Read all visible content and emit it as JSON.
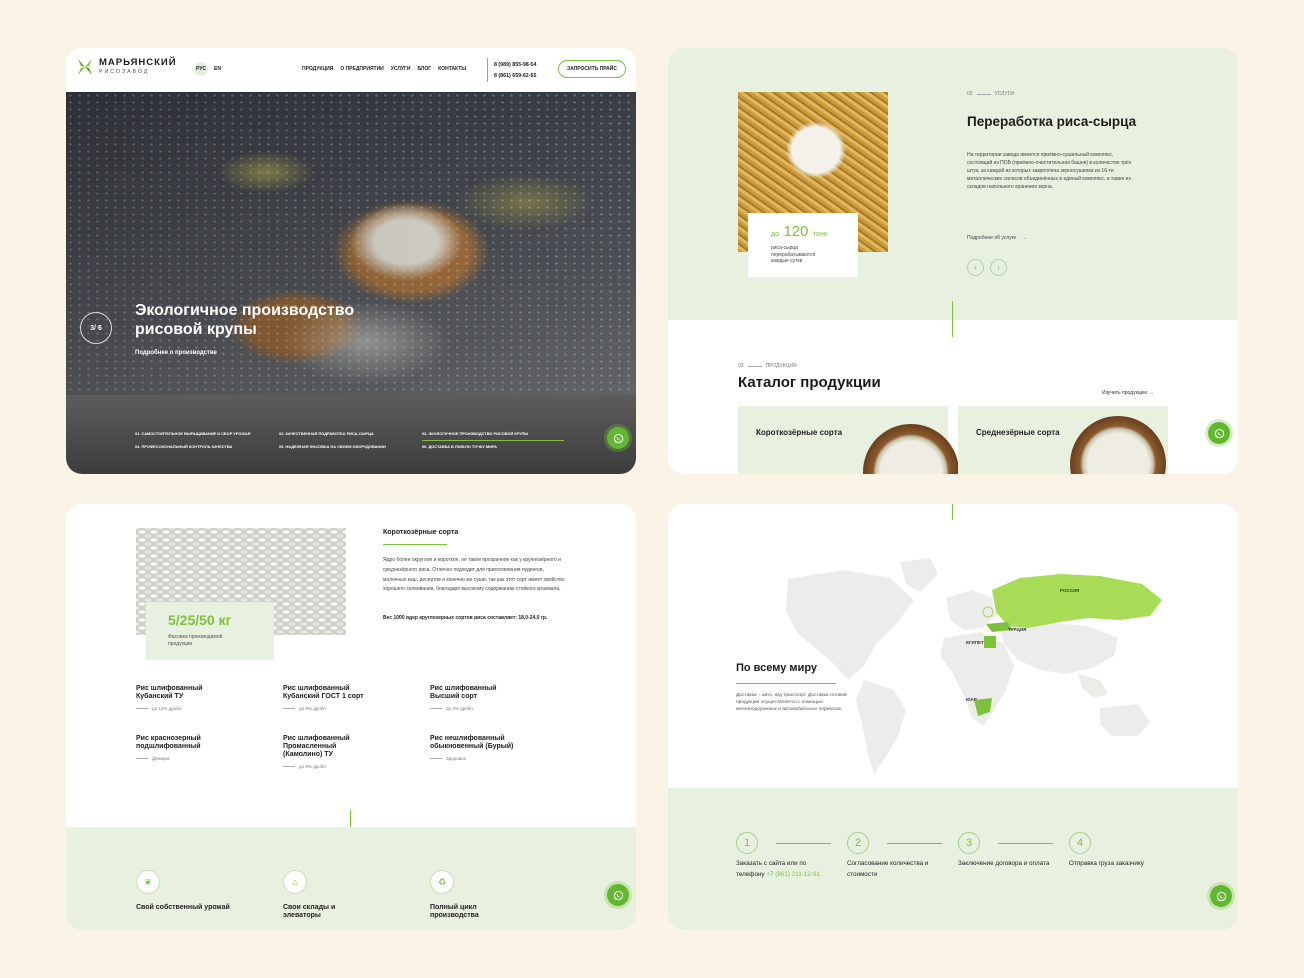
{
  "panel1": {
    "logo": {
      "title": "МАРЬЯНСКИЙ",
      "subtitle": "РИСОЗАВОД"
    },
    "lang": {
      "ru": "РУС",
      "en": "EN"
    },
    "nav": [
      "ПРОДУКЦИЯ",
      "О ПРЕДПРИЯТИИ",
      "УСЛУГИ",
      "БЛОГ",
      "КОНТАКТЫ"
    ],
    "phones": [
      "8 (989) 855-98-54",
      "8 (861) 659-62-65"
    ],
    "price_button": "ЗАПРОСИТЬ ПРАЙС",
    "slide_counter": "3/ 6",
    "hero_title": "Экологичное производство рисовой крупы",
    "hero_link": "Подробнее о производстве",
    "steps": [
      "01. САМОСТОЯТЕЛЬНОЕ ВЫРАЩИВАНИЕ И СБОР УРОЖАЯ",
      "02. КАЧЕСТВЕННАЯ ПОДРАБОТКА РИСА-СЫРЦА",
      "03. ЭКОЛОГИЧНОЕ ПРОИЗВОДСТВО РИСОВОЙ КРУПЫ",
      "04. ПРОФЕССИОНАЛЬНЫЙ КОНТРОЛЬ КАЧЕСТВА",
      "05. НАДЕЖНАЯ ФАСОВКА НА СВОЕМ ОБОРУДОВАНИИ",
      "06. ДОСТАВКА В ЛЮБУЮ ТОЧКУ МИРА"
    ],
    "active_step": 2
  },
  "panel2": {
    "eyebrow_num": "02",
    "eyebrow": "УСЛУГИ",
    "title": "Переработка риса-сырца",
    "text": "На территории завода имеется приёмно-сушильный комплекс, состоящий из ПОБ (приёмно-очистительная башня) в количестве трёх штук, за каждой из которых закреплена зерносушилка из 16-ти металлических силосов объединённых в единый комплекс, а также из складов напольного хранения зерна.",
    "more_link": "Подробнее об услуге",
    "stat_pre": "до",
    "stat_value": "120",
    "stat_unit": "тонн",
    "stat_caption": "риса-сырца перерабатываются каждые сутки",
    "catalog_eyebrow_num": "03",
    "catalog_eyebrow": "ПРОДУКЦИЯ",
    "catalog_title": "Каталог продукции",
    "study_link": "Изучить продукцию",
    "cards": [
      "Короткозёрные сорта",
      "Среднезёрные сорта"
    ]
  },
  "panel3": {
    "pack_value": "5/25/50 кг",
    "pack_caption": "Фасовка производимой продукции",
    "title": "Короткозёрные сорта",
    "text": "Ядро более округлое и короткое, не такое прозрачное как у крупнозёрного и среднезёрного риса. Отлично подходит для приготовления пудингов, молочных каш, десертов и конечно же суши, так как этот сорт имеет свойство хорошего склеивания, благодаря высокому содержанию стойкого крахмала.",
    "weight": "Вес 1000 ядер круглозерных сортов риса составляет: 18,0-24,0 гр.",
    "sorts": [
      {
        "name": "Рис шлифованный Кубанский ТУ",
        "note": "до 12% дробл"
      },
      {
        "name": "Рис шлифованный Кубанский ГОСТ 1 сорт",
        "note": "до 9% дробл"
      },
      {
        "name": "Рис шлифованный Высший сорт",
        "note": "до 4% дробл"
      },
      {
        "name": "Рис краснозерный подшлифованный",
        "note": "Девзира"
      },
      {
        "name": "Рис шлифованный Промасленный (Камолино) ТУ",
        "note": "до 9% дробл"
      },
      {
        "name": "Рис нешлифованный обыкновенный (Бурый)",
        "note": "Здоровье"
      }
    ],
    "features": [
      "Свой собственный урожай",
      "Свои склады и элеваторы",
      "Полный цикл производства"
    ]
  },
  "panel4": {
    "title": "По всему миру",
    "text": "Доставка – авто, ж/д транспорт. Доставка готовой продукции осуществляется с помощью железнодорожных и автомобильных перевозок.",
    "countries": [
      "РОССИЯ",
      "ТУРЦИЯ",
      "ЕГИПЕТ",
      "ЮАР"
    ],
    "steps": [
      {
        "num": "1",
        "text": "Заказать с сайта или по телефону",
        "phone": "+7 (861) 211-12-91"
      },
      {
        "num": "2",
        "text": "Согласование количества и стоимости"
      },
      {
        "num": "3",
        "text": "Заключение договора и оплата"
      },
      {
        "num": "4",
        "text": "Отправка груза заказчику"
      }
    ]
  },
  "colors": {
    "accent": "#7cc23a",
    "light_green": "#e8f1e0",
    "background": "#fbf3e6"
  },
  "icons": [
    "whatsapp-icon",
    "arrow-right-icon",
    "chevron-left-icon",
    "chevron-right-icon",
    "wheat-icon",
    "warehouse-icon",
    "recycle-icon"
  ]
}
